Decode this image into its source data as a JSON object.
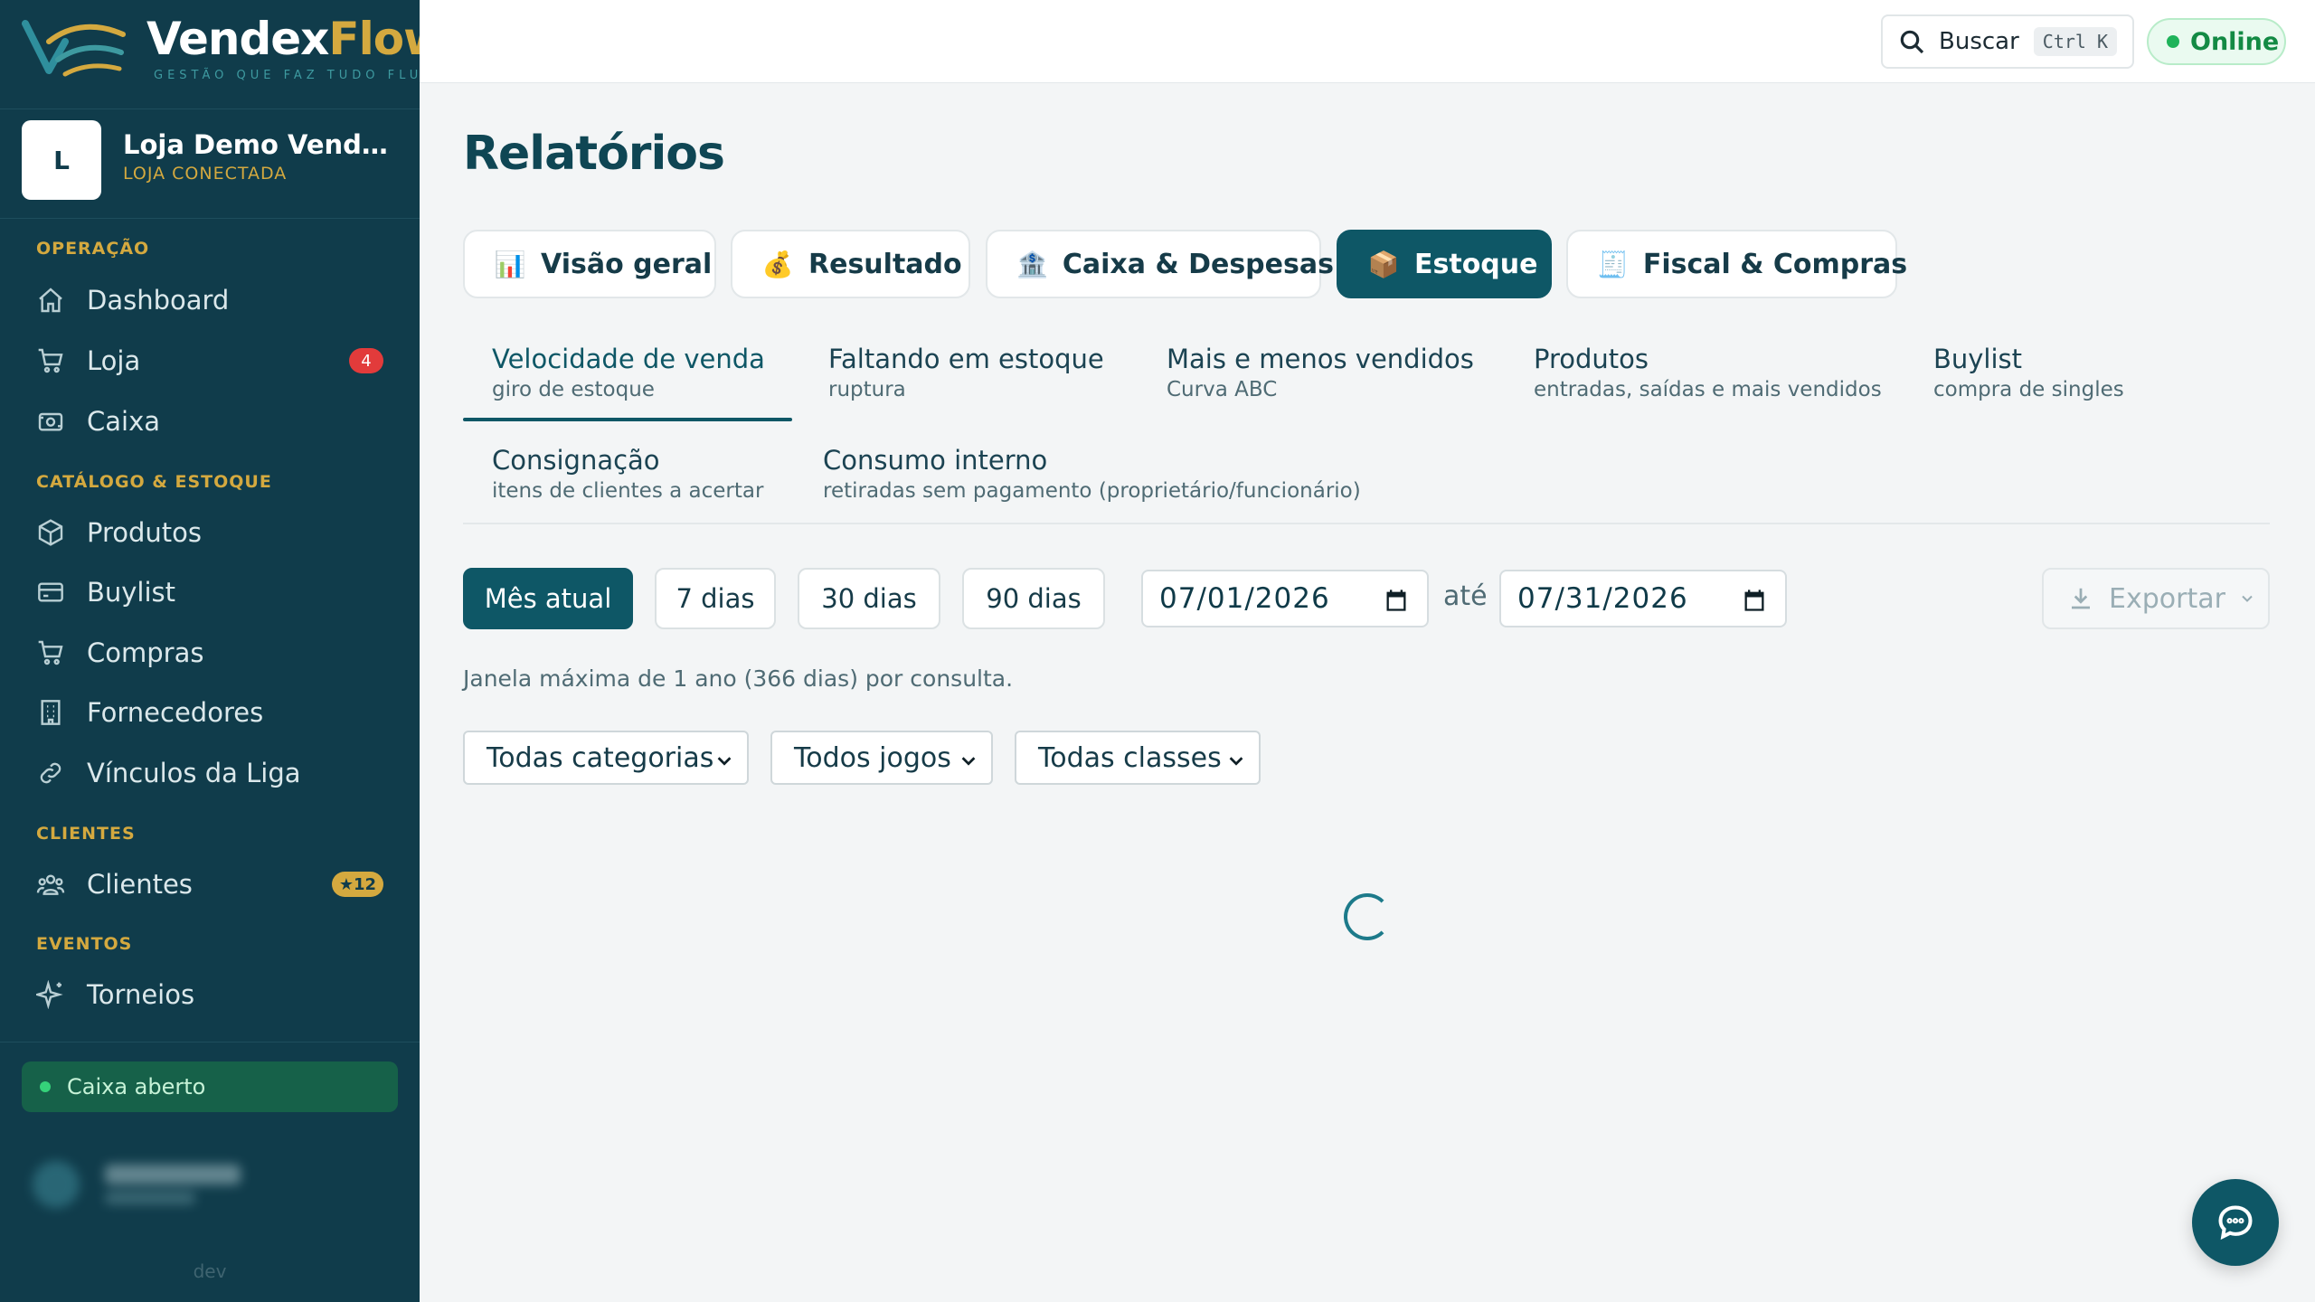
{
  "brand": {
    "name_main": "Vendex",
    "name_accent": "Flow",
    "tagline": "GESTÃO QUE FAZ TUDO FLUIR"
  },
  "store": {
    "initial": "L",
    "name": "Loja Demo VendexFl...",
    "status": "LOJA CONECTADA"
  },
  "sidebar": {
    "sections": {
      "operacao": "OPERAÇÃO",
      "catalogo": "CATÁLOGO & ESTOQUE",
      "clientes": "CLIENTES",
      "eventos": "EVENTOS"
    },
    "items": [
      {
        "label": "Dashboard",
        "icon": "home-icon"
      },
      {
        "label": "Loja",
        "icon": "cart-icon",
        "badge": "4"
      },
      {
        "label": "Caixa",
        "icon": "cash-register-icon"
      },
      {
        "label": "Produtos",
        "icon": "box-icon"
      },
      {
        "label": "Buylist",
        "icon": "card-icon"
      },
      {
        "label": "Compras",
        "icon": "cart-icon"
      },
      {
        "label": "Fornecedores",
        "icon": "building-icon"
      },
      {
        "label": "Vínculos da Liga",
        "icon": "link-icon"
      },
      {
        "label": "Clientes",
        "icon": "users-icon",
        "badge": "★12"
      },
      {
        "label": "Torneios",
        "icon": "sparkle-icon"
      }
    ],
    "cash_status": "Caixa aberto",
    "env": "dev"
  },
  "topbar": {
    "search_label": "Buscar",
    "search_shortcut": "Ctrl K",
    "status": "Online"
  },
  "page": {
    "title": "Relatórios"
  },
  "tabs": [
    {
      "emoji": "📊",
      "label": "Visão geral"
    },
    {
      "emoji": "💰",
      "label": "Resultado"
    },
    {
      "emoji": "🏦",
      "label": "Caixa & Despesas"
    },
    {
      "emoji": "📦",
      "label": "Estoque",
      "active": true
    },
    {
      "emoji": "🧾",
      "label": "Fiscal & Compras"
    }
  ],
  "subtabs": [
    {
      "title": "Velocidade de venda",
      "subtitle": "giro de estoque",
      "active": true
    },
    {
      "title": "Faltando em estoque",
      "subtitle": "ruptura"
    },
    {
      "title": "Mais e menos vendidos",
      "subtitle": "Curva ABC"
    },
    {
      "title": "Produtos",
      "subtitle": "entradas, saídas e mais vendidos"
    },
    {
      "title": "Buylist",
      "subtitle": "compra de singles"
    },
    {
      "title": "Consignação",
      "subtitle": "itens de clientes a acertar"
    },
    {
      "title": "Consumo interno",
      "subtitle": "retiradas sem pagamento (proprietário/funcionário)"
    }
  ],
  "period": {
    "chips": [
      "Mês atual",
      "7 dias",
      "30 dias",
      "90 dias"
    ],
    "active_chip": "Mês atual",
    "date_from": "07/01/2026",
    "separator": "até",
    "date_to": "07/31/2026",
    "export_label": "Exportar",
    "hint": "Janela máxima de 1 ano (366 dias) por consulta."
  },
  "filters": {
    "category": "Todas categorias",
    "game": "Todos jogos",
    "class": "Todas classes"
  },
  "colors": {
    "sidebar_bg": "#103c4b",
    "accent": "#0e5766",
    "gold": "#d4a93f",
    "online_green": "#1fb35a",
    "badge_red": "#e23b3b"
  }
}
